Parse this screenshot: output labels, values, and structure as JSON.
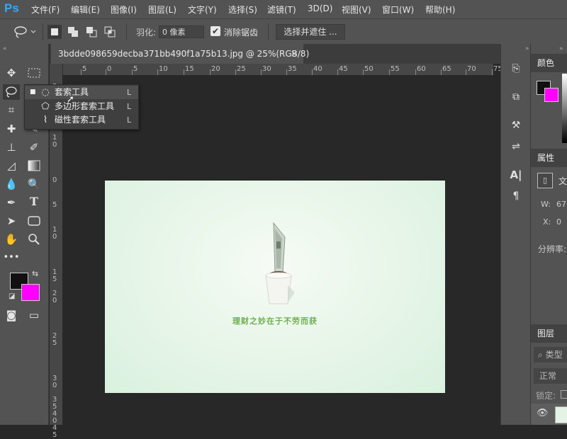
{
  "app": {
    "logo": "Ps"
  },
  "menu": [
    "文件(F)",
    "编辑(E)",
    "图像(I)",
    "图层(L)",
    "文字(Y)",
    "选择(S)",
    "滤镜(T)",
    "3D(D)",
    "视图(V)",
    "窗口(W)",
    "帮助(H)"
  ],
  "options": {
    "feather_label": "羽化:",
    "feather_value": "0 像素",
    "antialias_label": "消除锯齿",
    "antialias_checked": true,
    "select_mask_label": "选择并遮住 ..."
  },
  "document": {
    "tab_title": "3bdde098659decba371bb490f1a75b13.jpg @ 25%(RGB/8)",
    "caption": "理财之妙在于不劳而获"
  },
  "ruler": {
    "h_labels": [
      "5",
      "0",
      "5",
      "10",
      "15",
      "20",
      "25",
      "30",
      "35",
      "40",
      "45",
      "50",
      "55",
      "60",
      "65",
      "70",
      "75"
    ],
    "v_labels": [
      "5",
      "1 0",
      "0",
      "5",
      "1 0",
      "1 5",
      "2 0",
      "2 5",
      "3 0",
      "3 5",
      "4 0",
      "4 5"
    ]
  },
  "flyout": {
    "items": [
      {
        "label": "套索工具",
        "key": "L",
        "icon": "lasso-icon",
        "selected": true
      },
      {
        "label": "多边形套索工具",
        "key": "L",
        "icon": "polygonal-lasso-icon",
        "selected": false
      },
      {
        "label": "磁性套索工具",
        "key": "L",
        "icon": "magnetic-lasso-icon",
        "selected": false
      }
    ]
  },
  "colors": {
    "foreground": "#111111",
    "background": "#ff00ff",
    "accent": "#31a8ff"
  },
  "panels": {
    "color_tab": "颜色",
    "properties_tab": "属性",
    "properties_type": "文",
    "w_label": "W:",
    "w_value": "67.",
    "x_label": "X:",
    "x_value": "0",
    "resolution_label": "分辨率:",
    "layers_tab": "图层",
    "kind_label": "类型",
    "blend_mode": "正常",
    "lock_label": "锁定:"
  }
}
